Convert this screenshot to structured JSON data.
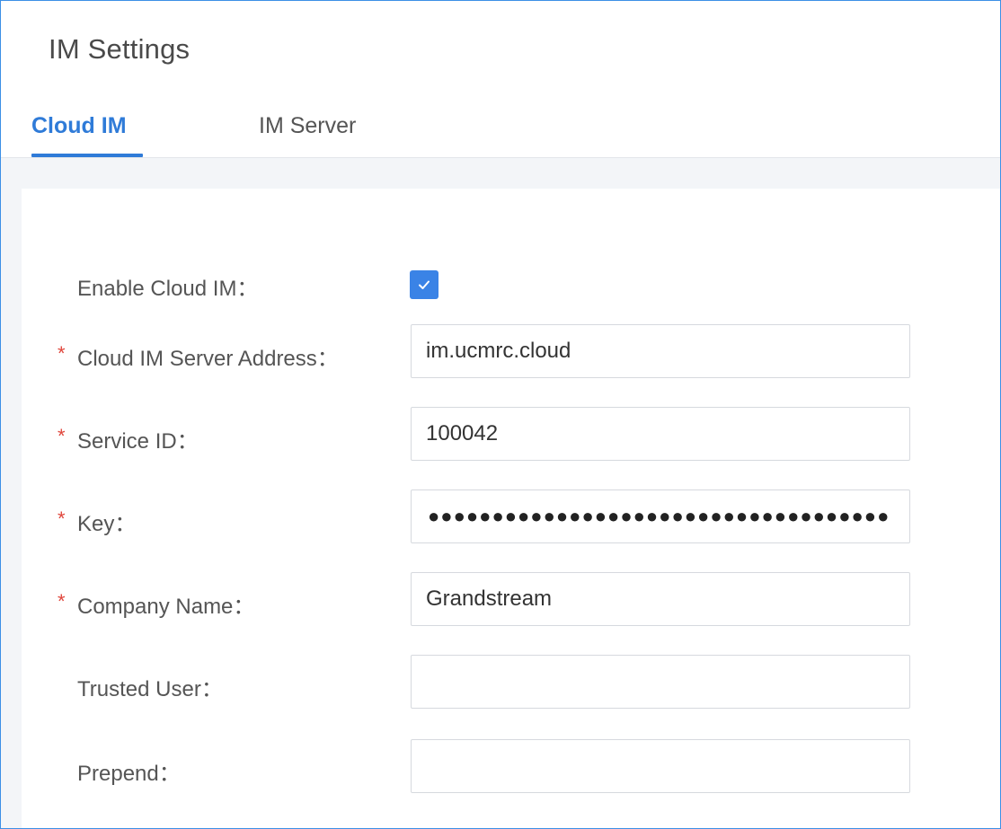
{
  "header": {
    "title": "IM Settings"
  },
  "tabs": [
    {
      "label": "Cloud IM",
      "active": true
    },
    {
      "label": "IM Server",
      "active": false
    }
  ],
  "form": {
    "enable_cloud_im": {
      "label": "Enable Cloud IM：",
      "checked": true,
      "icon": "check-icon"
    },
    "server_address": {
      "label": "Cloud IM Server Address：",
      "required_mark": "*",
      "value": "im.ucmrc.cloud"
    },
    "service_id": {
      "label": "Service ID：",
      "required_mark": "*",
      "value": "100042"
    },
    "key": {
      "label": "Key：",
      "required_mark": "*",
      "masked_value": "●●●●●●●●●●●●●●●●●●●●●●●●●●●●●●●●●●●●"
    },
    "company_name": {
      "label": "Company Name：",
      "required_mark": "*",
      "value": "Grandstream"
    },
    "trusted_user": {
      "label": "Trusted User：",
      "value": ""
    },
    "prepend": {
      "label": "Prepend：",
      "value": ""
    }
  },
  "colors": {
    "accent": "#2f7bd8",
    "required": "#e0463c",
    "checkbox": "#3a83e6"
  }
}
